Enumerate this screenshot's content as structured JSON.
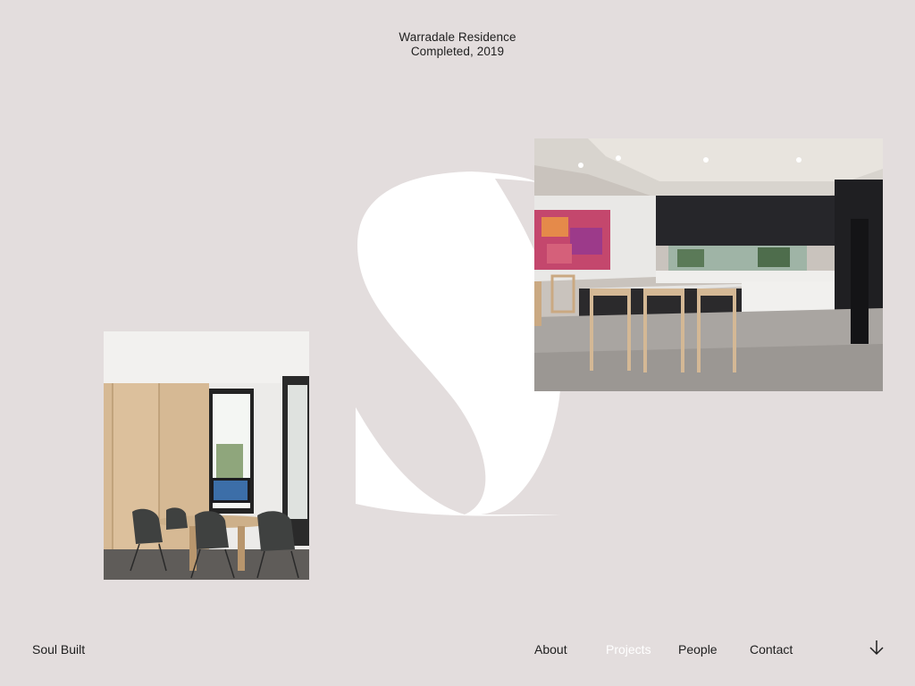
{
  "project": {
    "name": "Warradale Residence",
    "status": "Completed, 2019"
  },
  "brand": {
    "name": "Soul Built"
  },
  "nav": {
    "items": [
      {
        "label": "About",
        "active": false
      },
      {
        "label": "Projects",
        "active": true
      },
      {
        "label": "People",
        "active": false
      },
      {
        "label": "Contact",
        "active": false
      }
    ]
  },
  "icons": {
    "monogram": "s-monogram-logo",
    "scroll": "arrow-down-icon"
  },
  "colors": {
    "background": "#e3dddd",
    "text": "#1e1e1e",
    "active_nav": "#ffffff",
    "monogram": "#ffffff"
  }
}
